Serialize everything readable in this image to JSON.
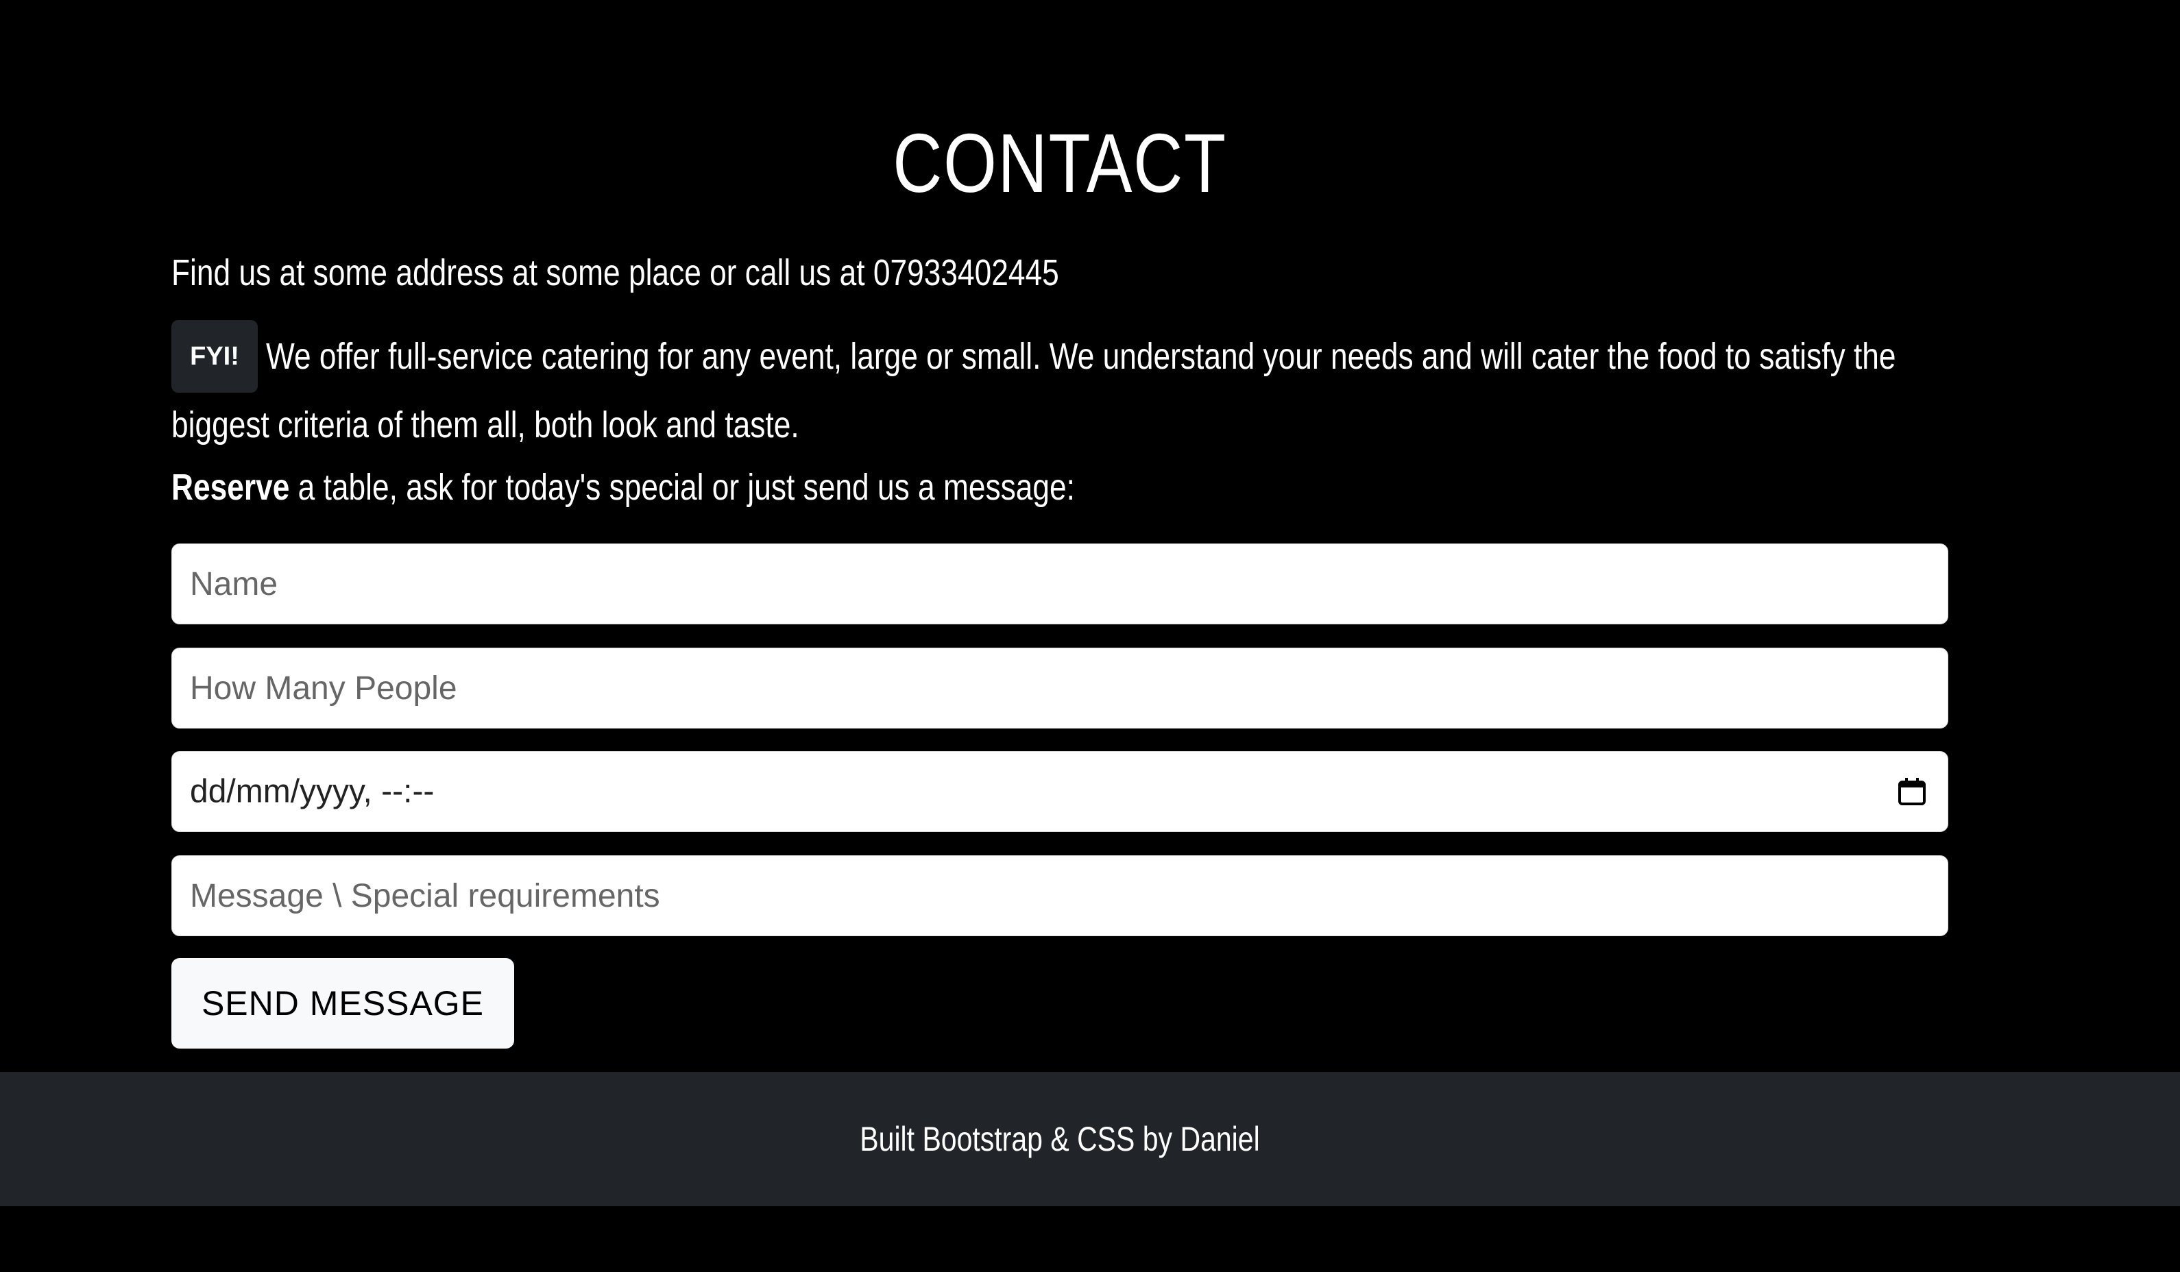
{
  "page": {
    "title": "CONTACT",
    "address_line": "Find us at some address at some place or call us at 07933402445",
    "catering": {
      "badge": "FYI!",
      "line_1": "We offer full-service catering for any event, large or small. We understand your needs and will cater the food to satisfy the",
      "line_2": "biggest criteria of them all, both look and taste."
    },
    "reserve": {
      "strong": "Reserve",
      "rest": " a table, ask for today's special or just send us a message:"
    }
  },
  "form": {
    "name_placeholder": "Name",
    "people_placeholder": "How Many People",
    "datetime_display": "dd/mm/yyyy, --:--",
    "message_placeholder": "Message \\ Special requirements",
    "submit_label": "SEND MESSAGE"
  },
  "footer": {
    "text": "Built Bootstrap & CSS by Daniel"
  },
  "icons": {
    "calendar": "calendar-icon"
  }
}
